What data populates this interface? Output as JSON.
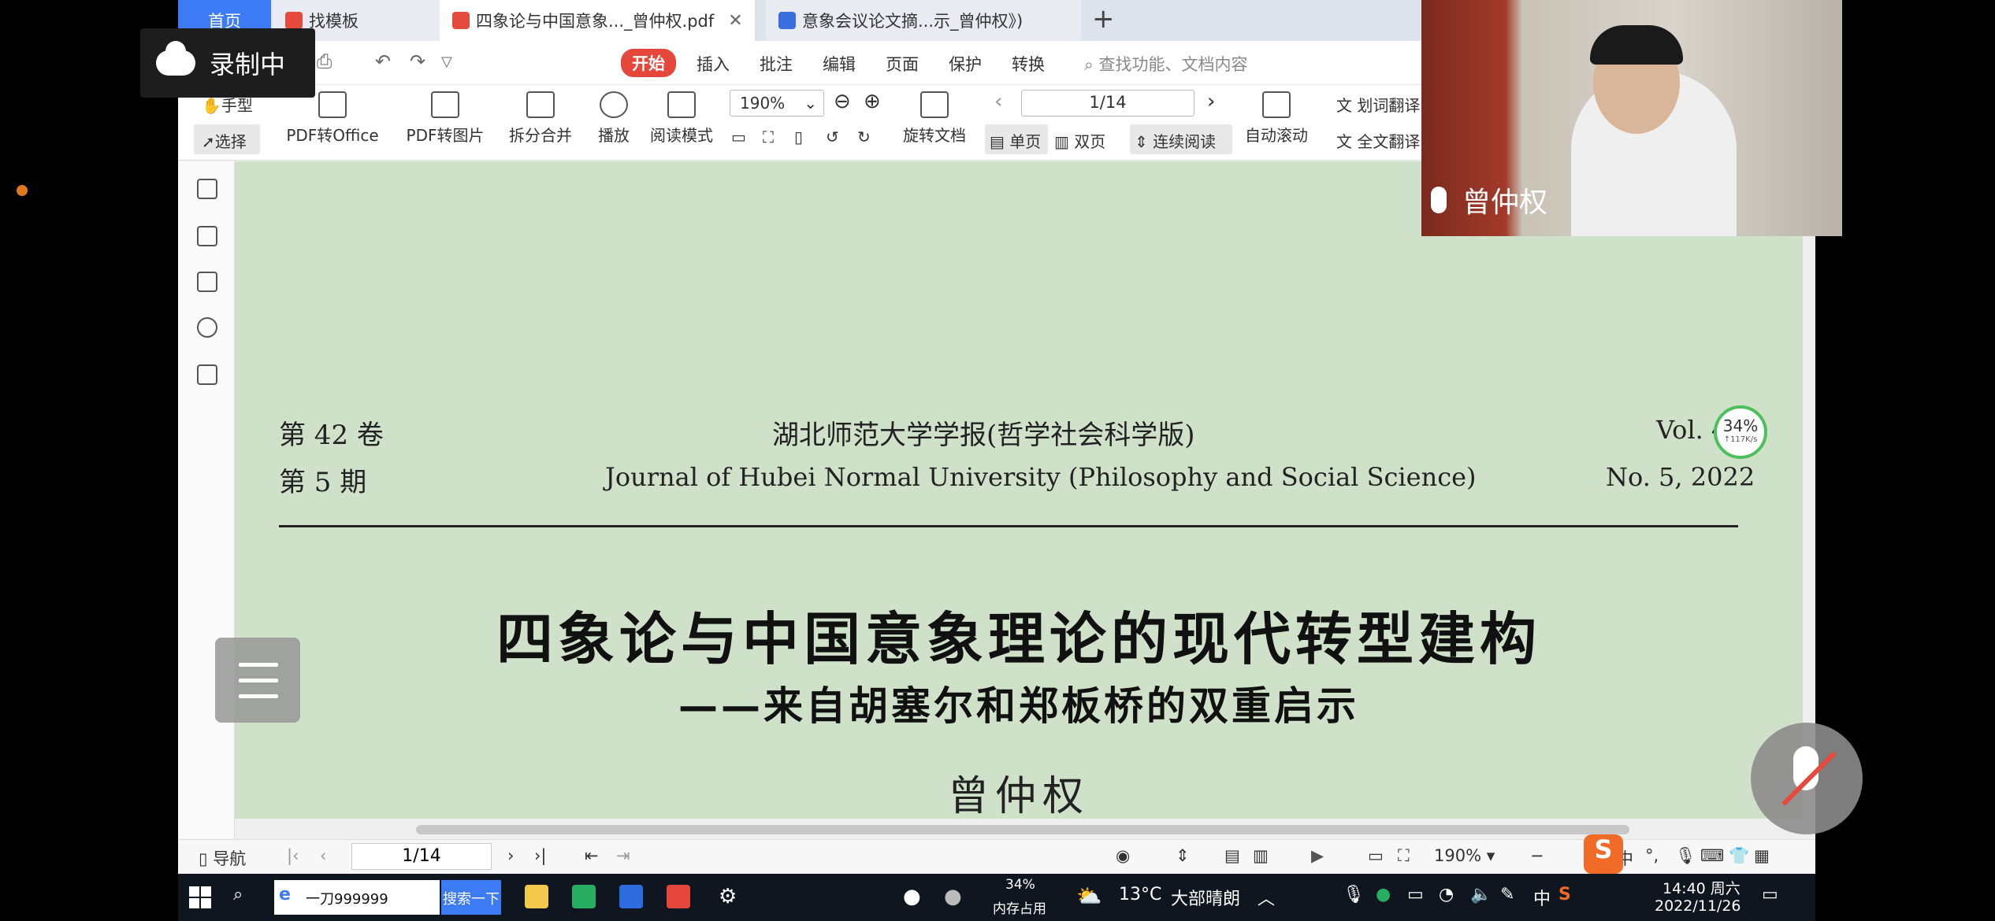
{
  "tabs": {
    "home": "首页",
    "templates": "找模板",
    "doc1": "四象论与中国意象..._曾仲权.pdf",
    "doc2": "意象会议论文摘...示_曾仲权》)"
  },
  "menu": {
    "start": "开始",
    "insert": "插入",
    "annotate": "批注",
    "edit": "编辑",
    "page": "页面",
    "protect": "保护",
    "convert": "转换",
    "search_placeholder": "查找功能、文档内容"
  },
  "toolbar": {
    "hand": "手型",
    "select": "选择",
    "pdf_to_office": "PDF转Office",
    "pdf_to_image": "PDF转图片",
    "split_merge": "拆分合并",
    "play": "播放",
    "read_mode": "阅读模式",
    "zoom": "190%",
    "page": "1/14",
    "rotate": "旋转文档",
    "single": "单页",
    "double": "双页",
    "continuous": "连续阅读",
    "autoscroll": "自动滚动",
    "word_translate": "划词翻译",
    "full_translate": "全文翻译"
  },
  "document": {
    "volume": "第 42 卷",
    "issue": "第 5 期",
    "journal_cn": "湖北师范大学学报(哲学社会科学版)",
    "journal_en": "Journal of Hubei Normal University (Philosophy and Social Science)",
    "vol_en": "Vol. 4",
    "no_en": "No. 5, 2022",
    "title": "四象论与中国意象理论的现代转型建构",
    "subtitle": "——来自胡塞尔和郑板桥的双重启示",
    "author": "曾仲权"
  },
  "statusbar": {
    "nav": "导航",
    "page": "1/14",
    "zoom": "190%"
  },
  "taskbar": {
    "search_text": "一刀999999",
    "search_button": "搜索一下",
    "memory_percent": "34%",
    "memory_label": "内存占用",
    "temperature": "13°C",
    "weather": "大部晴朗",
    "ime": "中",
    "time": "14:40 周六",
    "date": "2022/11/26"
  },
  "overlay": {
    "recording": "录制中",
    "speaker": "曾仲权",
    "net_percent": "34%",
    "net_speed": "↑117K/s"
  },
  "colors": {
    "page_bg": "#cfe2c9",
    "accent_red": "#e5473a",
    "accent_blue": "#3c7bf4"
  }
}
